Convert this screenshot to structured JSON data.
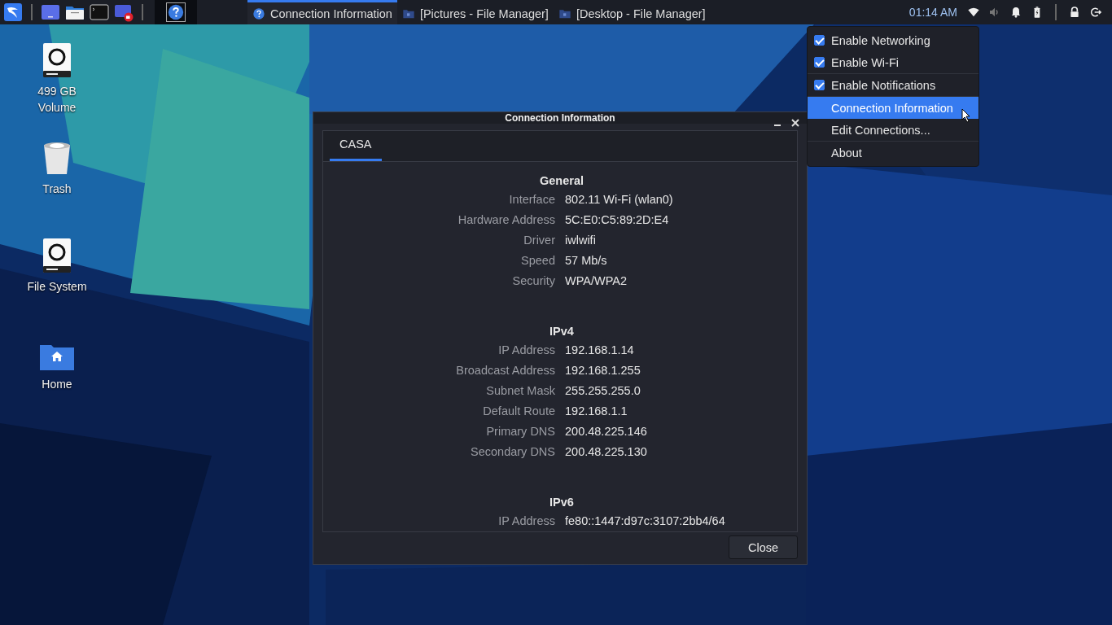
{
  "taskbar": {
    "tasks": [
      {
        "label": "Connection Information",
        "kind": "help",
        "selected": true
      },
      {
        "label": "[Pictures - File Manager]",
        "kind": "folder",
        "selected": false
      },
      {
        "label": "[Desktop - File Manager]",
        "kind": "folder",
        "selected": false
      }
    ],
    "clock": "01:14 AM"
  },
  "desktop_icons": [
    {
      "label": "499 GB Volume",
      "kind": "drive"
    },
    {
      "label": "Trash",
      "kind": "trash"
    },
    {
      "label": "File System",
      "kind": "drive"
    },
    {
      "label": "Home",
      "kind": "home"
    }
  ],
  "dialog": {
    "title": "Connection Information",
    "tabs": [
      {
        "label": "CASA",
        "selected": true
      }
    ],
    "sections": [
      {
        "heading": "General",
        "rows": [
          {
            "label": "Interface",
            "value": "802.11 Wi-Fi (wlan0)"
          },
          {
            "label": "Hardware Address",
            "value": "5C:E0:C5:89:2D:E4"
          },
          {
            "label": "Driver",
            "value": "iwlwifi"
          },
          {
            "label": "Speed",
            "value": "57 Mb/s"
          },
          {
            "label": "Security",
            "value": "WPA/WPA2"
          }
        ]
      },
      {
        "heading": "IPv4",
        "rows": [
          {
            "label": "IP Address",
            "value": "192.168.1.14"
          },
          {
            "label": "Broadcast Address",
            "value": "192.168.1.255"
          },
          {
            "label": "Subnet Mask",
            "value": "255.255.255.0"
          },
          {
            "label": "Default Route",
            "value": "192.168.1.1"
          },
          {
            "label": "Primary DNS",
            "value": "200.48.225.146"
          },
          {
            "label": "Secondary DNS",
            "value": "200.48.225.130"
          }
        ]
      },
      {
        "heading": "IPv6",
        "rows": [
          {
            "label": "IP Address",
            "value": "fe80::1447:d97c:3107:2bb4/64"
          }
        ]
      }
    ],
    "button": "Close"
  },
  "menu": {
    "sections": [
      [
        {
          "label": "Enable Networking",
          "kind": "check",
          "checked": true,
          "selected": false
        },
        {
          "label": "Enable Wi-Fi",
          "kind": "check",
          "checked": true,
          "selected": false
        }
      ],
      [
        {
          "label": "Enable Notifications",
          "kind": "check",
          "checked": true,
          "selected": false
        }
      ],
      [
        {
          "label": "Connection Information",
          "kind": "action",
          "selected": true
        },
        {
          "label": "Edit Connections...",
          "kind": "action",
          "selected": false
        }
      ],
      [
        {
          "label": "About",
          "kind": "action",
          "selected": false
        }
      ]
    ]
  }
}
